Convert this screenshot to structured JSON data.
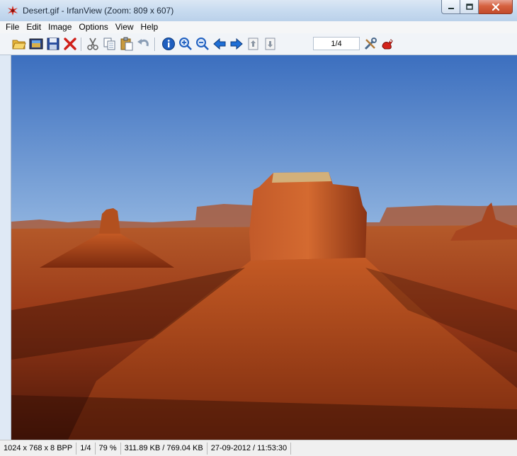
{
  "window": {
    "title": "Desert.gif - IrfanView (Zoom: 809 x 607)",
    "buttons": {
      "minimize": "minimize",
      "maximize": "maximize",
      "close": "close"
    }
  },
  "menu": [
    "File",
    "Edit",
    "Image",
    "Options",
    "View",
    "Help"
  ],
  "toolbar": {
    "tools": [
      {
        "name": "open-folder-icon"
      },
      {
        "name": "slideshow-icon"
      },
      {
        "name": "save-icon"
      },
      {
        "name": "delete-icon"
      },
      {
        "name": "cut-icon"
      },
      {
        "name": "copy-icon"
      },
      {
        "name": "paste-icon"
      },
      {
        "name": "undo-icon"
      },
      {
        "name": "info-icon"
      },
      {
        "name": "zoom-in-icon"
      },
      {
        "name": "zoom-out-icon"
      },
      {
        "name": "previous-icon"
      },
      {
        "name": "next-icon"
      },
      {
        "name": "first-page-icon"
      },
      {
        "name": "last-page-icon"
      },
      {
        "name": "options-icon"
      },
      {
        "name": "about-icon"
      }
    ],
    "page_indicator": "1/4"
  },
  "status": {
    "dimensions": "1024 x 768 x 8 BPP",
    "page": "1/4",
    "zoom": "79 %",
    "filesize": "311.89 KB / 769.04 KB",
    "datetime": "27-09-2012 / 11:53:30"
  },
  "colors": {
    "title_accent": "#d92b1c",
    "sky_top": "#3c6fbf",
    "rock": "#b4461e"
  }
}
